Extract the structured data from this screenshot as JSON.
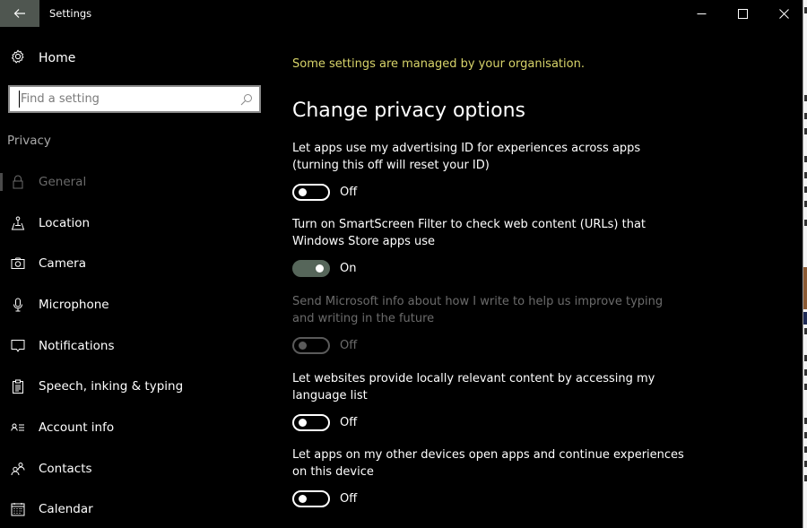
{
  "window": {
    "title": "Settings",
    "controls": {
      "minimize": "minimize-icon",
      "maximize": "maximize-icon",
      "close": "close-icon"
    },
    "back_icon": "back-arrow-icon"
  },
  "sidebar": {
    "home_label": "Home",
    "home_icon": "gear-icon",
    "search": {
      "value": "",
      "placeholder": "Find a setting",
      "icon": "search-icon"
    },
    "section_label": "Privacy",
    "items": [
      {
        "label": "General",
        "icon": "lock-icon",
        "active": true
      },
      {
        "label": "Location",
        "icon": "location-icon",
        "active": false
      },
      {
        "label": "Camera",
        "icon": "camera-icon",
        "active": false
      },
      {
        "label": "Microphone",
        "icon": "microphone-icon",
        "active": false
      },
      {
        "label": "Notifications",
        "icon": "notification-icon",
        "active": false
      },
      {
        "label": "Speech, inking & typing",
        "icon": "clipboard-icon",
        "active": false
      },
      {
        "label": "Account info",
        "icon": "account-info-icon",
        "active": false
      },
      {
        "label": "Contacts",
        "icon": "contacts-icon",
        "active": false
      },
      {
        "label": "Calendar",
        "icon": "calendar-icon",
        "active": false
      }
    ]
  },
  "main": {
    "managed_notice": "Some settings are managed by your organisation.",
    "heading": "Change privacy options",
    "settings": [
      {
        "description": "Let apps use my advertising ID for experiences across apps (turning this off will reset your ID)",
        "state": "Off",
        "on": false,
        "disabled": false
      },
      {
        "description": "Turn on SmartScreen Filter to check web content (URLs) that Windows Store apps use",
        "state": "On",
        "on": true,
        "disabled": false
      },
      {
        "description": "Send Microsoft info about how I write to help us improve typing and writing in the future",
        "state": "Off",
        "on": false,
        "disabled": true
      },
      {
        "description": "Let websites provide locally relevant content by accessing my language list",
        "state": "Off",
        "on": false,
        "disabled": false
      },
      {
        "description": "Let apps on my other devices open apps and continue experiences on this device",
        "state": "Off",
        "on": false,
        "disabled": false
      }
    ]
  },
  "colors": {
    "background": "#000000",
    "accent_toggle_on": "#56665a",
    "managed_notice": "#d8d46a",
    "back_button": "#4f5650",
    "disabled_text": "#6b6b6b"
  }
}
